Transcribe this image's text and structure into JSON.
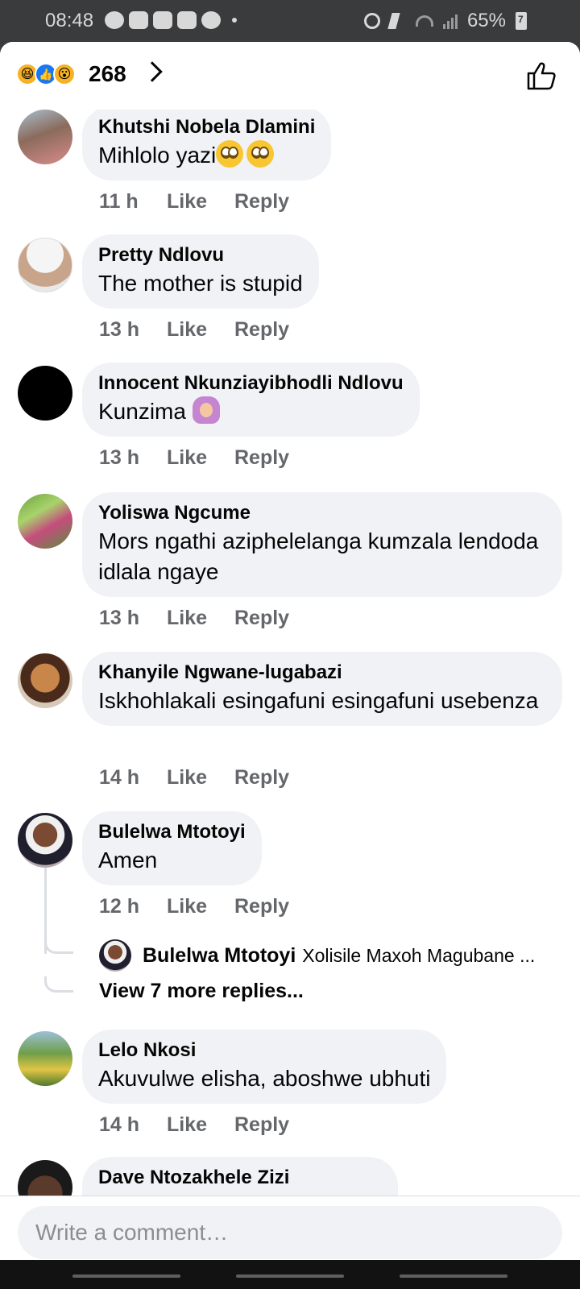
{
  "status_bar": {
    "time": "08:48",
    "battery": "65%"
  },
  "reactions": {
    "count": "268",
    "icons": [
      "haha-icon",
      "like-icon",
      "wow-icon"
    ]
  },
  "comments": [
    {
      "author": "Khutshi Nobela Dlamini",
      "text": "Mihlolo yazi",
      "emoji": "eye-roll-emoji x2",
      "time": "11 h",
      "like": "Like",
      "reply": "Reply"
    },
    {
      "author": "Pretty Ndlovu",
      "text": "The mother is stupid",
      "time": "13 h",
      "like": "Like",
      "reply": "Reply"
    },
    {
      "author": "Innocent Nkunziayibhodli Ndlovu",
      "text": "Kunzima",
      "emoji": "facepalm-emoji",
      "time": "13 h",
      "like": "Like",
      "reply": "Reply"
    },
    {
      "author": "Yoliswa Ngcume",
      "text": "Mors ngathi aziphelelanga kumzala lendoda idlala ngaye",
      "time": "13 h",
      "like": "Like",
      "reply": "Reply"
    },
    {
      "author": "Khanyile Ngwane-lugabazi",
      "text": "Iskhohlakali esingafuni esingafuni usebenza",
      "time": "14 h",
      "like": "Like",
      "reply": "Reply"
    },
    {
      "author": "Bulelwa Mtotoyi",
      "text": "Amen",
      "time": "12 h",
      "like": "Like",
      "reply": "Reply"
    },
    {
      "author": "Lelo Nkosi",
      "text": "Akuvulwe elisha, aboshwe ubhuti",
      "time": "14 h",
      "like": "Like",
      "reply": "Reply"
    },
    {
      "author": "Dave Ntozakhele Zizi"
    }
  ],
  "reply_preview": {
    "author": "Bulelwa Mtotoyi",
    "text": "Xolisile Maxoh Magubane ...",
    "view_more": "View 7 more replies..."
  },
  "composer": {
    "placeholder": "Write a comment…"
  },
  "colors": {
    "bubble": "#f0f2f5",
    "meta_text": "#65676b",
    "like_blue": "#1877f2"
  }
}
